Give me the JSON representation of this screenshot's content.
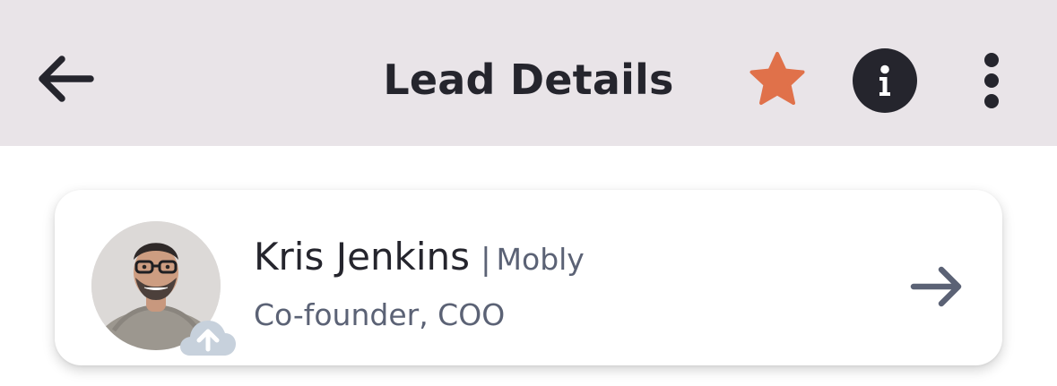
{
  "header": {
    "title": "Lead Details",
    "back_icon": "arrow-left-icon",
    "favorite_icon": "star-icon",
    "info_icon": "info-icon",
    "more_icon": "more-vertical-icon",
    "background_color": "#e9e4e8",
    "star_color": "#e0714a",
    "icon_color": "#25252d"
  },
  "lead_card": {
    "name": "Kris Jenkins",
    "separator": "|",
    "company": "Mobly",
    "title": "Co-founder, COO",
    "avatar_icon": "profile-photo",
    "upload_icon": "cloud-upload-icon",
    "open_icon": "arrow-right-icon",
    "accent_color": "#5b6275"
  }
}
